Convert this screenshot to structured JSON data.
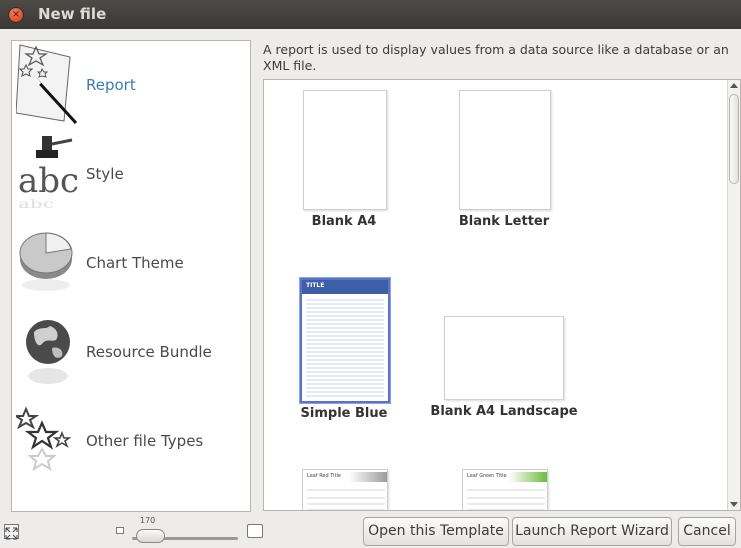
{
  "window": {
    "title": "New file"
  },
  "categories": [
    {
      "label": "Report",
      "icon": "magic-wand-icon",
      "selected": true
    },
    {
      "label": "Style",
      "icon": "paint-brush-abc-icon",
      "selected": false
    },
    {
      "label": "Chart Theme",
      "icon": "pie-chart-icon",
      "selected": false
    },
    {
      "label": "Resource Bundle",
      "icon": "globe-icon",
      "selected": false
    },
    {
      "label": "Other file Types",
      "icon": "stars-icon",
      "selected": false
    }
  ],
  "description": "A report is used to display values from a data source like a database or an XML file.",
  "templates": [
    {
      "name": "Blank A4"
    },
    {
      "name": "Blank Letter"
    },
    {
      "name": "Simple Blue",
      "selected": true,
      "thumb_title": "TITLE"
    },
    {
      "name": "Blank A4 Landscape"
    },
    {
      "name": "",
      "thumb_title": "Leaf Red Title"
    },
    {
      "name": "",
      "thumb_title": "Leaf Green Title"
    }
  ],
  "zoom": {
    "value": "170"
  },
  "buttons": {
    "open_template": "Open this Template",
    "launch_wizard": "Launch Report Wizard",
    "cancel": "Cancel"
  },
  "colors": {
    "accent": "#3b7ab8",
    "selection": "#5a73c8",
    "titlebar": "#3c3b37"
  }
}
